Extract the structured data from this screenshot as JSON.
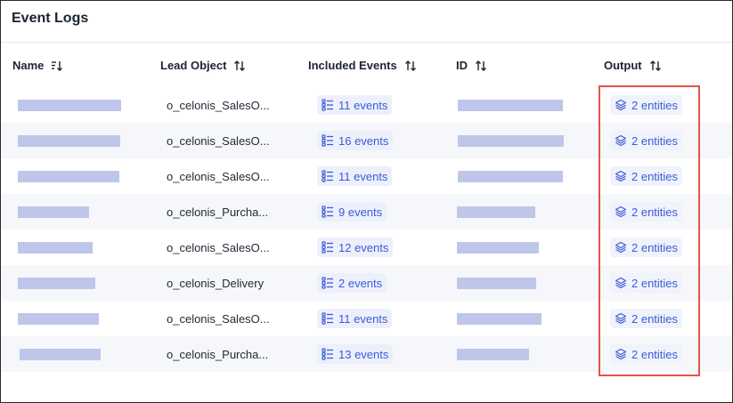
{
  "header": {
    "title": "Event Logs"
  },
  "columns": [
    {
      "key": "name",
      "label": "Name",
      "sort_icon": "sort-descending-icon"
    },
    {
      "key": "lead_object",
      "label": "Lead Object",
      "sort_icon": "sort-icon"
    },
    {
      "key": "included_events",
      "label": "Included Events",
      "sort_icon": "sort-icon"
    },
    {
      "key": "id",
      "label": "ID",
      "sort_icon": "sort-icon"
    },
    {
      "key": "output",
      "label": "Output",
      "sort_icon": "sort-icon"
    }
  ],
  "rows": [
    {
      "lead_object": "o_celonis_SalesO...",
      "included_events": "11 events",
      "output": "2 entities"
    },
    {
      "lead_object": "o_celonis_SalesO...",
      "included_events": "16 events",
      "output": "2 entities"
    },
    {
      "lead_object": "o_celonis_SalesO...",
      "included_events": "11 events",
      "output": "2 entities"
    },
    {
      "lead_object": "o_celonis_Purcha...",
      "included_events": "9 events",
      "output": "2 entities"
    },
    {
      "lead_object": "o_celonis_SalesO...",
      "included_events": "12 events",
      "output": "2 entities"
    },
    {
      "lead_object": "o_celonis_Delivery",
      "included_events": "2 events",
      "output": "2 entities"
    },
    {
      "lead_object": "o_celonis_SalesO...",
      "included_events": "11 events",
      "output": "2 entities"
    },
    {
      "lead_object": "o_celonis_Purcha...",
      "included_events": "13 events",
      "output": "2 entities"
    }
  ],
  "colors": {
    "accent": "#3b5bd9",
    "redacted": "#bec6ea",
    "highlight": "#e4534b",
    "row_alt": "#f6f7fa"
  },
  "icons": {
    "events": "event-list-icon",
    "output": "layers-icon"
  }
}
